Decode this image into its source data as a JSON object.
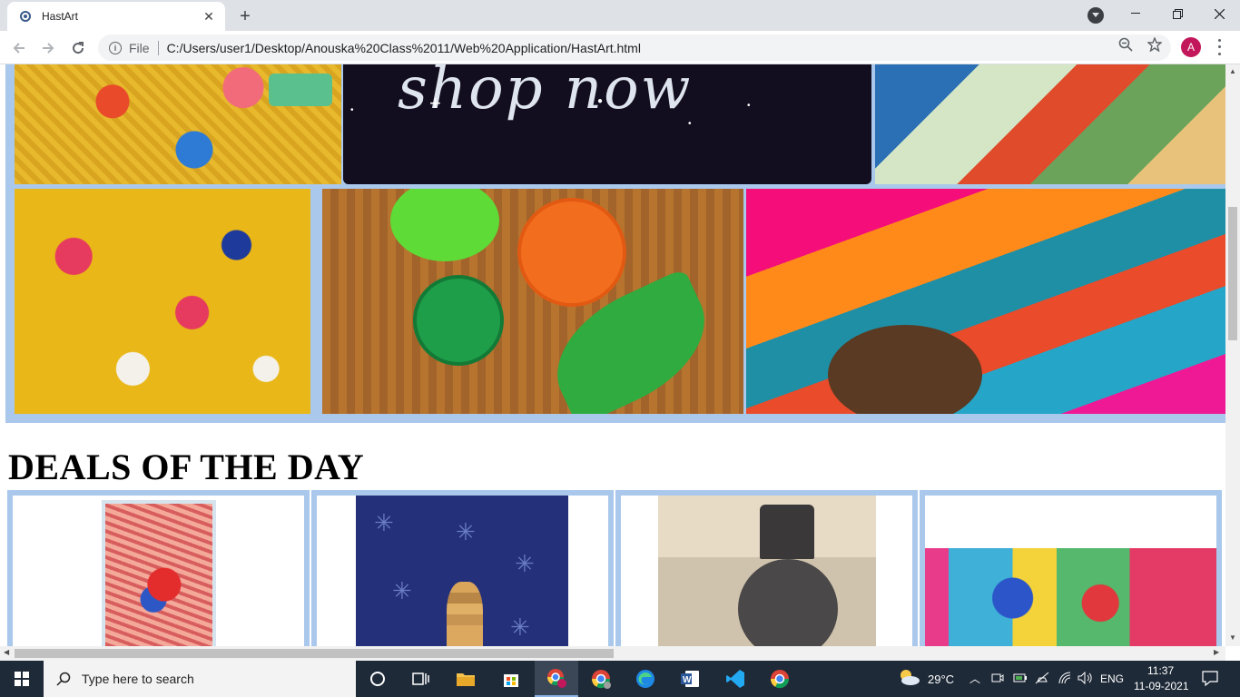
{
  "browser": {
    "tab_title": "HastArt",
    "scheme_label": "File",
    "url": "C:/Users/user1/Desktop/Anouska%20Class%2011/Web%20Application/HastArt.html",
    "profile_initial": "A"
  },
  "page": {
    "banner_text": "shop now",
    "deals_heading": "DEALS OF THE DAY"
  },
  "taskbar": {
    "search_placeholder": "Type here to search",
    "weather": "29°C",
    "language": "ENG",
    "time": "11:37",
    "date": "11-09-2021"
  },
  "colors": {
    "card_border": "#a9c8ec",
    "tab_strip": "#dee1e6",
    "taskbar": "#1f2a38",
    "avatar": "#c2185b"
  }
}
